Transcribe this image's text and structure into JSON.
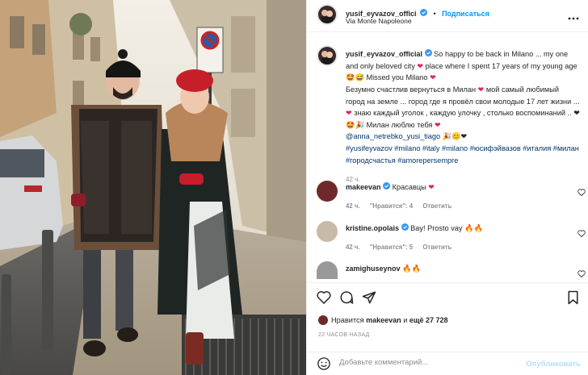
{
  "header": {
    "username": "yusif_eyvazov_offici",
    "separator": "•",
    "follow_label": "Подписаться",
    "location": "Via Monte Napoleone",
    "more_icon": "more-horizontal-icon"
  },
  "post_caption": {
    "username": "yusif_eyvazov_official",
    "text_part1": "So happy to be back in Milano ... my one and only beloved city ",
    "text_part2": " place where I spent 17 years of my young age ",
    "text_part3": " Missed you Milano ",
    "ru_part1": "Безумно счастлив вернуться в Милан ",
    "ru_part2": " мой самый любимый город на земле ... город где я провёл свои молодые 17 лет жизни ... ",
    "ru_part3": " знаю каждый уголок , каждую улочку , столько воспоминаний .. ",
    "ru_part4": " Милан люблю тебя ",
    "mention1": "@anna_netrebko_yusi_tiago",
    "hashtags": "#yusifeyvazov #milano #italy #milano #юсифэйвазов #италия #милан #городсчастья #amorepersempre",
    "time": "42 ч."
  },
  "comments": [
    {
      "username": "makeevan",
      "text": "Красавцы ",
      "time": "42 ч.",
      "likes": "\"Нравится\": 4",
      "reply": "Ответить"
    },
    {
      "username": "kristine.opolais",
      "text": "Bay! Prosto vay",
      "time": "42 ч.",
      "likes": "\"Нравится\": 5",
      "reply": "Ответить"
    },
    {
      "username": "zamighuseynov",
      "text": ""
    }
  ],
  "likes": {
    "prefix": "Нравится ",
    "user": "makeevan",
    "middle": " и ",
    "count": "ещё 27 728"
  },
  "time_ago": "22 ЧАСОВ НАЗАД",
  "add_comment": {
    "placeholder": "Добавьте комментарий...",
    "post_label": "Опубликовать"
  },
  "colors": {
    "accent": "#0095f6",
    "heart": "#ed4956",
    "muted": "#8e8e8e",
    "link": "#00376b"
  }
}
